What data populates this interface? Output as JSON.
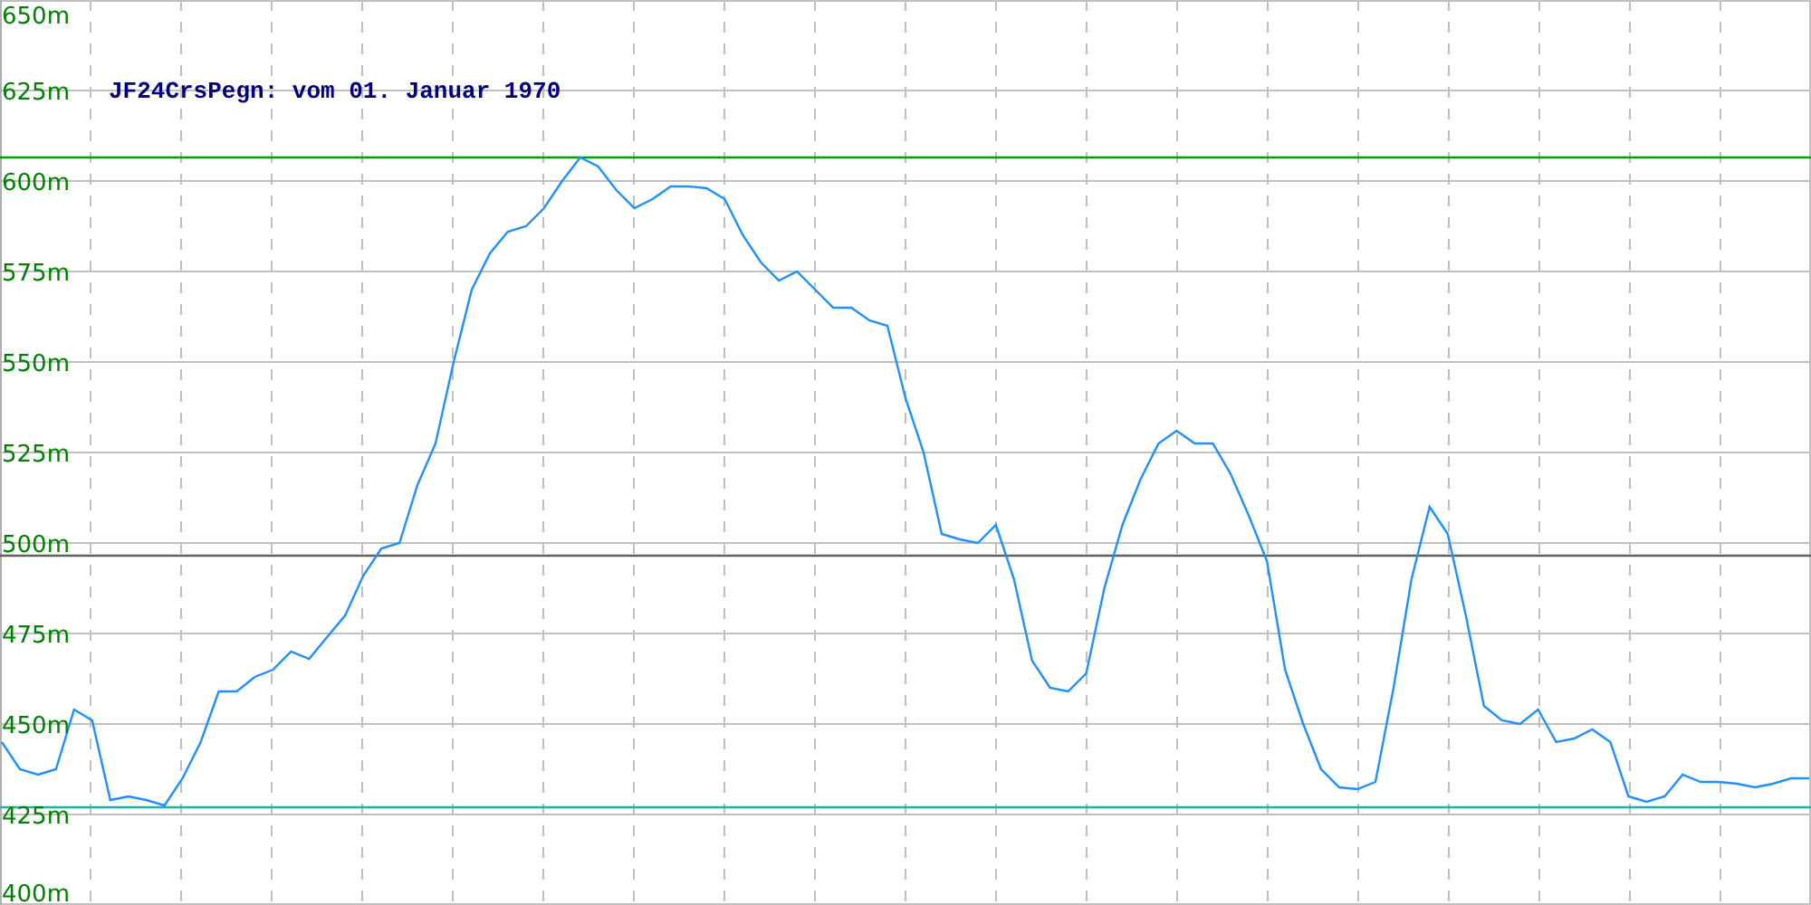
{
  "chart_data": {
    "type": "line",
    "title": "JF24CrsPegn: vom 01. Januar 1970",
    "ylim": [
      400,
      650
    ],
    "yticks": [
      {
        "value": 400,
        "label": "400m"
      },
      {
        "value": 425,
        "label": "425m"
      },
      {
        "value": 450,
        "label": "450m"
      },
      {
        "value": 475,
        "label": "475m"
      },
      {
        "value": 500,
        "label": "500m"
      },
      {
        "value": 525,
        "label": "525m"
      },
      {
        "value": 550,
        "label": "550m"
      },
      {
        "value": 575,
        "label": "575m"
      },
      {
        "value": 600,
        "label": "600m"
      },
      {
        "value": 625,
        "label": "625m"
      },
      {
        "value": 650,
        "label": "650m"
      }
    ],
    "grid": true,
    "series": [
      {
        "color": "#1e90ff",
        "values": [
          445,
          437.5,
          436,
          437.5,
          454,
          451,
          429,
          430,
          429,
          427.5,
          435,
          445,
          459,
          459,
          463,
          465,
          470,
          468,
          474,
          480,
          491,
          498.5,
          500,
          516,
          527.5,
          550,
          570,
          580,
          586,
          587.5,
          592.5,
          600,
          606.5,
          604,
          597.5,
          592.5,
          595,
          598.5,
          598.5,
          598,
          595,
          585,
          577.5,
          572.5,
          575,
          570,
          565,
          565,
          561.5,
          560,
          540,
          525,
          502.5,
          501,
          500,
          505,
          490,
          467.5,
          460,
          459,
          464,
          487.5,
          505,
          517.5,
          527.5,
          531,
          527.5,
          527.5,
          519,
          507.5,
          495,
          465,
          450,
          437.5,
          432.5,
          432,
          434,
          460,
          490,
          510,
          502.5,
          480,
          455,
          451,
          450,
          454,
          445,
          446,
          448.5,
          445,
          430,
          428.5,
          430,
          436,
          434,
          434,
          433.5,
          432.5,
          433.5,
          435,
          435
        ]
      }
    ],
    "ref_lines": [
      {
        "axis": "y",
        "value": 606.5,
        "color": "#00a000"
      },
      {
        "axis": "y",
        "value": 496.5,
        "color": "#606060"
      },
      {
        "axis": "y",
        "value": 427,
        "color": "#20b2aa"
      }
    ]
  }
}
